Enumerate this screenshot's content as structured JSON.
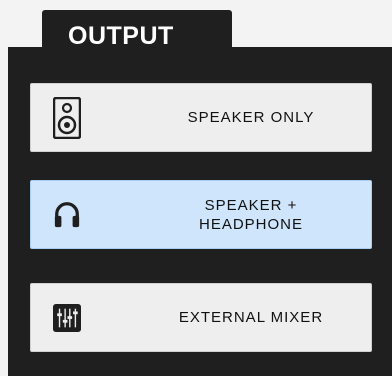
{
  "tab": {
    "label": "OUTPUT"
  },
  "options": [
    {
      "label": "SPEAKER ONLY",
      "icon": "speaker-icon",
      "selected": false
    },
    {
      "label": "SPEAKER +\nHEADPHONE",
      "icon": "headphone-icon",
      "selected": true
    },
    {
      "label": "EXTERNAL MIXER",
      "icon": "mixer-icon",
      "selected": false
    }
  ],
  "colors": {
    "panel": "#1f1f1f",
    "button": "#eeeeee",
    "selected": "#cfe5fb",
    "icon": "#1f1f1f"
  }
}
